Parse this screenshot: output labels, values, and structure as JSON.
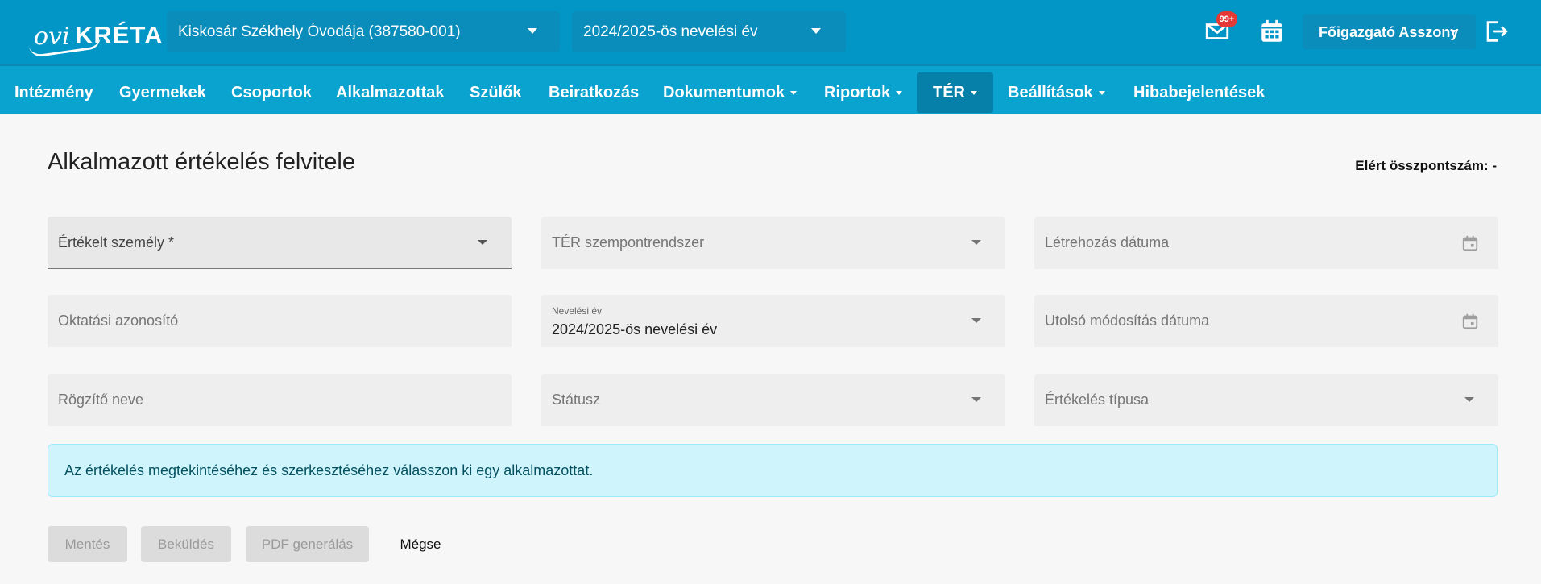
{
  "header": {
    "logo_ovi": "ovi",
    "logo_kreta": "KRÉTA",
    "institution_select": "Kiskosár Székhely Óvodája (387580-001)",
    "year_select": "2024/2025-ös nevelési év",
    "mail_badge": "99+",
    "user_name": "Főigazgató Asszony",
    "icons": [
      "mail-icon",
      "calendar-icon",
      "logout-icon"
    ]
  },
  "nav": {
    "items": [
      {
        "label": "Intézmény"
      },
      {
        "label": "Gyermekek"
      },
      {
        "label": "Csoportok"
      },
      {
        "label": "Alkalmazottak"
      },
      {
        "label": "Szülők"
      },
      {
        "label": "Beiratkozás"
      },
      {
        "label": "Dokumentumok"
      },
      {
        "label": "Riportok"
      },
      {
        "label": "TÉR"
      },
      {
        "label": "Beállítások"
      },
      {
        "label": "Hibabejelentések"
      }
    ],
    "active": "TÉR"
  },
  "page": {
    "title": "Alkalmazott értékelés felvitele",
    "score_label": "Elért összpontszám: -"
  },
  "form": {
    "evaluated_person": "Értékelt személy *",
    "ter_system": "TÉR szempontrendszer",
    "created_date": "Létrehozás dátuma",
    "education_id": "Oktatási azonosító",
    "school_year_label": "Nevelési év",
    "school_year_value": "2024/2025-ös nevelési év",
    "modified_date": "Utolsó módosítás dátuma",
    "recorder_name": "Rögzítő neve",
    "status": "Státusz",
    "evaluation_type": "Értékelés típusa"
  },
  "info_message": "Az értékelés megtekintéséhez és szerkesztéséhez válasszon ki egy alkalmazottat.",
  "buttons": {
    "save": "Mentés",
    "send": "Beküldés",
    "pdf": "PDF generálás",
    "cancel": "Mégse"
  },
  "colors": {
    "header_bg": "#0196c5",
    "nav_bg": "#0aa2cf",
    "nav_active_bg": "#0680a8",
    "info_bg": "#cff4fc",
    "badge": "#e53935"
  }
}
